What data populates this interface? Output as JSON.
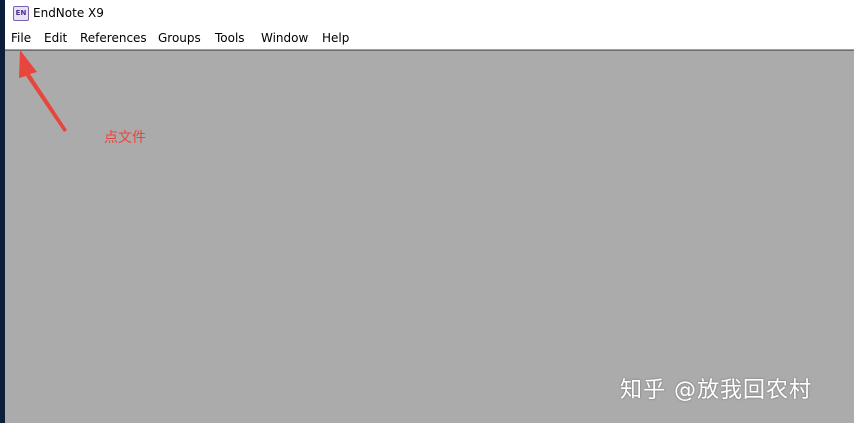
{
  "app": {
    "icon_text": "EN",
    "title": "EndNote X9"
  },
  "menu": {
    "items": [
      "File",
      "Edit",
      "References",
      "Groups",
      "Tools",
      "Window",
      "Help"
    ]
  },
  "annotation": {
    "text": "点文件",
    "color": "#e8453c"
  },
  "watermark": {
    "text": "知乎 @放我回农村"
  },
  "colors": {
    "workspace": "#ababab",
    "left_edge": "#0b1f3a"
  }
}
